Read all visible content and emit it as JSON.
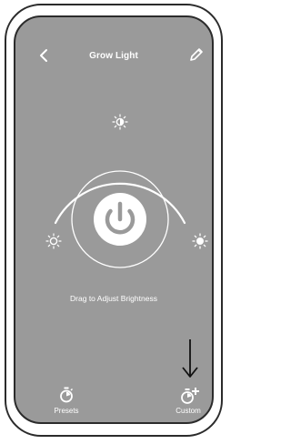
{
  "header": {
    "title": "Grow Light",
    "back_icon": "chevron-left-icon",
    "edit_icon": "pencil-icon"
  },
  "control": {
    "hint": "Drag to Adjust Brightness",
    "power_icon": "power-icon",
    "brightness_icons": [
      "sun-low-icon",
      "sun-medium-icon",
      "sun-high-icon"
    ]
  },
  "tabs": [
    {
      "label": "Presets",
      "icon": "timer-icon"
    },
    {
      "label": "Custom",
      "icon": "timer-plus-icon"
    }
  ],
  "colors": {
    "screen": "#9a9a9a",
    "foreground": "#ffffff",
    "frame": "#2b2b2b"
  }
}
